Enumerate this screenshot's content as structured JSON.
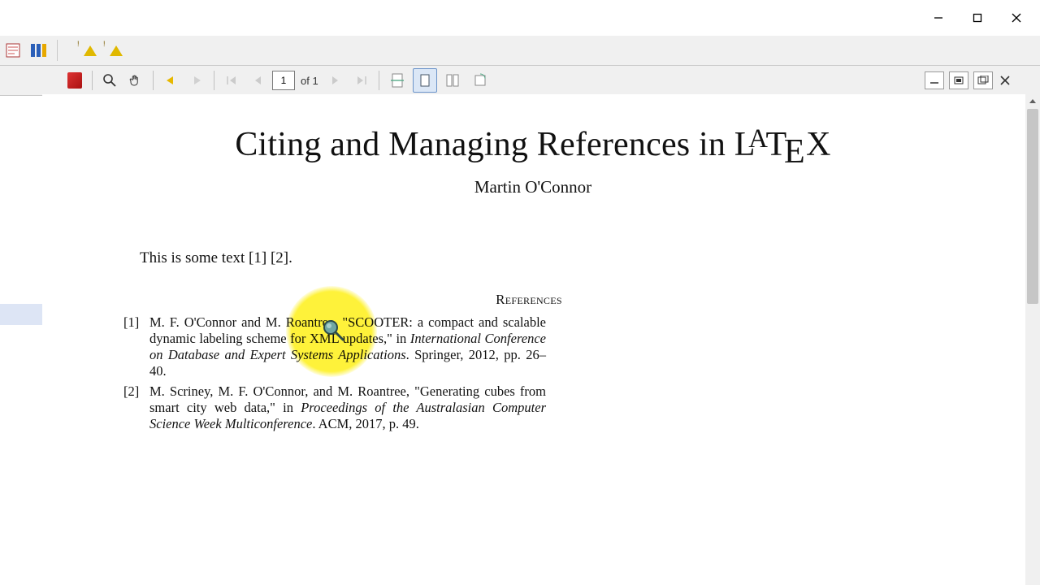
{
  "page_nav": {
    "current": "1",
    "of_label": "of",
    "total": "1"
  },
  "document": {
    "title_pre": "Citing and Managing References in ",
    "latex_word": "LATEX",
    "author": "Martin O'Connor",
    "body_line": "This is some text [1] [2].",
    "references_heading": "References",
    "refs": [
      {
        "num": "[1]",
        "plain1": "M. F. O'Connor and M. Roantree, \"SCOOTER: a compact and scalable dynamic labeling scheme for XML updates,\" in ",
        "ital": "International Conference on Database and Expert Systems Applications",
        "plain2": ".   Springer, 2012, pp. 26–40."
      },
      {
        "num": "[2]",
        "plain1": "M. Scriney, M. F. O'Connor, and M. Roantree, \"Generating cubes from smart city web data,\" in ",
        "ital": "Proceedings of the Australasian Computer Science Week Multiconference",
        "plain2": ".   ACM, 2017, p. 49."
      }
    ]
  }
}
